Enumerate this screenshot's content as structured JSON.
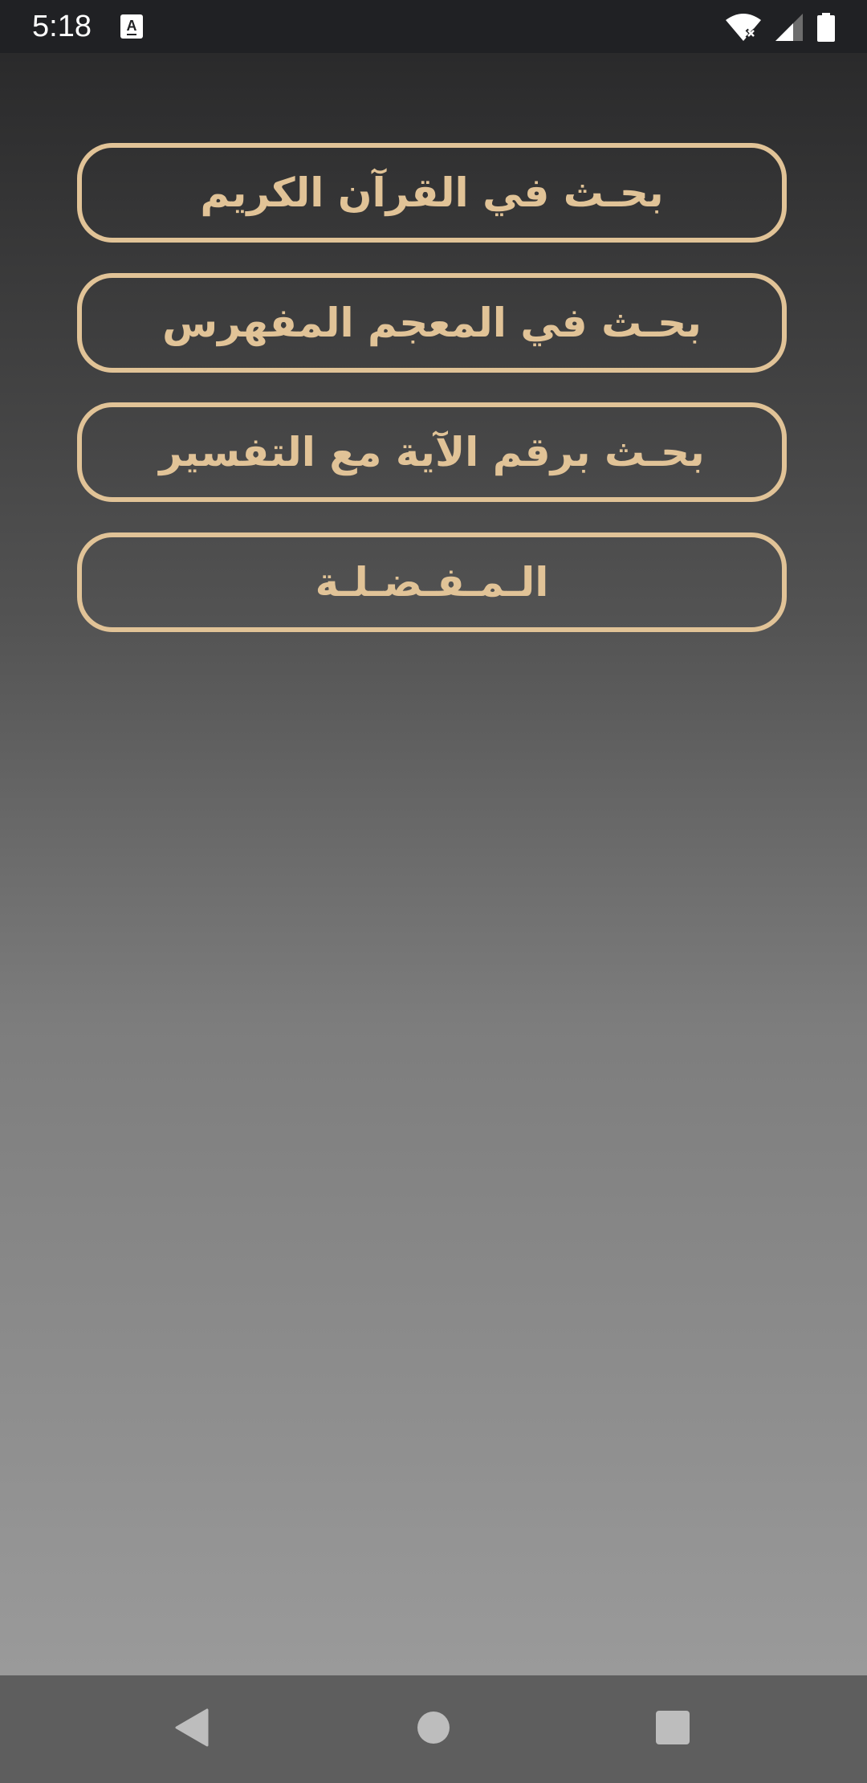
{
  "status_bar": {
    "time": "5:18",
    "notification_icon": "keyboard-a-icon",
    "wifi_icon": "wifi-x-icon",
    "signal_icon": "cell-signal-icon",
    "battery_icon": "battery-full-icon"
  },
  "menu": {
    "items": [
      {
        "label": "بحـث في القرآن الكريم"
      },
      {
        "label": "بحـث في المعجم المفهرس"
      },
      {
        "label": "بحـث برقم الآية مع التفسير"
      },
      {
        "label": "الـمـفـضـلـة"
      }
    ]
  },
  "nav_bar": {
    "back_icon": "back-triangle-icon",
    "home_icon": "home-circle-icon",
    "recents_icon": "recents-square-icon"
  },
  "colors": {
    "accent": "#e1c397",
    "status_bar": "#202124",
    "nav_bar": "#5e5e5e"
  }
}
